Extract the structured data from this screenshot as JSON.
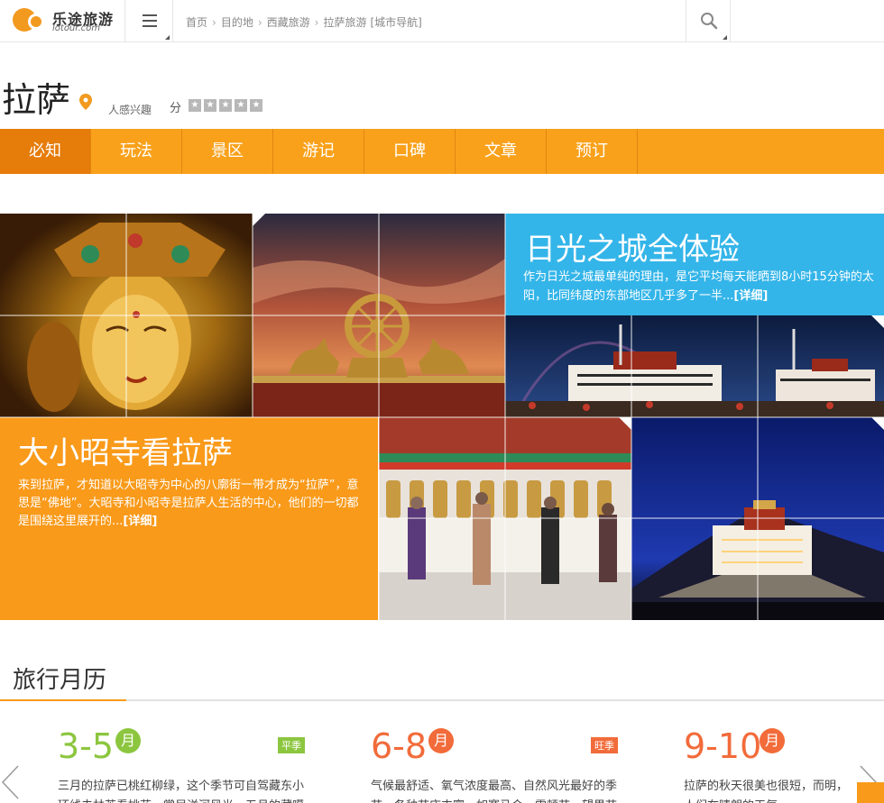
{
  "header": {
    "logo_text": "乐途旅游",
    "logo_domain": "lotour.com",
    "breadcrumb": [
      "首页",
      "目的地",
      "西藏旅游",
      "拉萨旅游",
      "[城市导航]"
    ]
  },
  "city": {
    "name": "拉萨",
    "interest_text": "人感兴趣",
    "score_label": "分"
  },
  "nav": {
    "items": [
      "必知",
      "玩法",
      "景区",
      "游记",
      "口碑",
      "文章",
      "预订"
    ],
    "active": "必知"
  },
  "features": {
    "sun": {
      "title": "日光之城全体验",
      "text": "作为日光之城最单纯的理由，是它平均每天能晒到8小时15分钟的太阳，比同纬度的东部地区几乎多了一半...",
      "more": "[详细]"
    },
    "temple": {
      "title": "大小昭寺看拉萨",
      "text": "来到拉萨，才知道以大昭寺为中心的八廓街一带才成为“拉萨”，意思是“佛地”。大昭寺和小昭寺是拉萨人生活的中心，他们的一切都是围绕这里展开的...",
      "more": "[详细]"
    }
  },
  "calendar": {
    "title": "旅行月历",
    "seasons": [
      {
        "range": "3-5",
        "month": "月",
        "badge": "平季",
        "color": "#8cc63f",
        "badge_color": "#8cc63f",
        "desc": "三月的拉萨已桃红柳绿，这个季节可自驾藏东小环线去林芝看桃花，赏尼洋河风光，五月的藏噶达万花可"
      },
      {
        "range": "6-8",
        "month": "月",
        "badge": "旺季",
        "color": "#f26b3a",
        "badge_color": "#f26b3a",
        "desc": "气候最舒适、氧气浓度最高、自然风光最好的季节，各种节庆丰富，如赛马会、雪顿节、望果节等等，再"
      },
      {
        "range": "9-10",
        "month": "月",
        "badge": "",
        "color": "#f26b3a",
        "badge_color": "#f26b3a",
        "desc": "拉萨的秋天很美也很短，而明，人们在晴朗的天气"
      }
    ]
  }
}
